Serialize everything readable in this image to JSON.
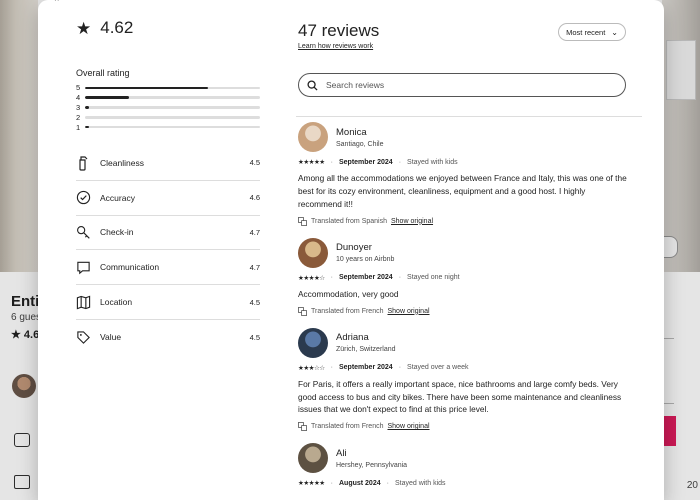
{
  "background": {
    "listing_title": "Enti",
    "guests": "6 gues",
    "rating": "4.6",
    "price_fragment": "20"
  },
  "modal": {
    "top_glyph": "⌃",
    "summary": {
      "score": "4.62"
    },
    "overall_label": "Overall rating",
    "distribution": [
      {
        "stars": "5",
        "fraction": 0.7
      },
      {
        "stars": "4",
        "fraction": 0.25
      },
      {
        "stars": "3",
        "fraction": 0.02
      },
      {
        "stars": "2",
        "fraction": 0.0
      },
      {
        "stars": "1",
        "fraction": 0.02
      }
    ],
    "categories": [
      {
        "label": "Cleanliness",
        "value": "4.5",
        "icon": "spray-bottle-icon"
      },
      {
        "label": "Accuracy",
        "value": "4.6",
        "icon": "check-circle-icon"
      },
      {
        "label": "Check-in",
        "value": "4.7",
        "icon": "key-icon"
      },
      {
        "label": "Communication",
        "value": "4.7",
        "icon": "chat-bubble-icon"
      },
      {
        "label": "Location",
        "value": "4.5",
        "icon": "map-icon"
      },
      {
        "label": "Value",
        "value": "4.5",
        "icon": "tag-icon"
      }
    ],
    "reviews_count": "47 reviews",
    "learn_link": "Learn how reviews work",
    "sort_label": "Most recent",
    "search_placeholder": "Search reviews",
    "reviews": [
      {
        "name": "Monica",
        "sub": "Santiago, Chile",
        "stars": 5,
        "date": "September 2024",
        "stay": "Stayed with kids",
        "text": "Among all the accommodations we enjoyed between France and Italy, this was one of the best for its cozy environment, cleanliness, equipment and a good host. I highly recommend it!!",
        "translated": "Translated from Spanish",
        "show_original": "Show original",
        "avatar_colors": [
          "#e9d8c6",
          "#c9a27e"
        ]
      },
      {
        "name": "Dunoyer",
        "sub": "10 years on Airbnb",
        "stars": 4,
        "date": "September 2024",
        "stay": "Stayed one night",
        "text": "Accommodation, very good",
        "translated": "Translated from French",
        "show_original": "Show original",
        "avatar_colors": [
          "#d9b98a",
          "#8a5a3a"
        ]
      },
      {
        "name": "Adriana",
        "sub": "Zürich, Switzerland",
        "stars": 3,
        "date": "September 2024",
        "stay": "Stayed over a week",
        "text": "For Paris, it offers a really important space, nice bathrooms and large comfy beds. Very good access to bus and city bikes. There have been some maintenance and cleanliness issues that we don't expect to find at this price level.",
        "translated": "Translated from French",
        "show_original": "Show original",
        "avatar_colors": [
          "#5a79a6",
          "#2b3a4e"
        ]
      },
      {
        "name": "Ali",
        "sub": "Hershey, Pennsylvania",
        "stars": 5,
        "date": "August 2024",
        "stay": "Stayed with kids",
        "text": "",
        "translated": "",
        "show_original": "",
        "avatar_colors": [
          "#b9a98f",
          "#5d5142"
        ]
      }
    ]
  },
  "colors": {
    "accent": "#e31c5f",
    "text": "#222222",
    "divider": "#dddddd"
  }
}
